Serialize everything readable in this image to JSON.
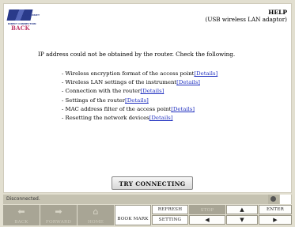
{
  "header": {
    "logo_line1": "INTERNET",
    "logo_line2": "DIRECT CONNECTION",
    "title": "HELP",
    "subtitle": "(USB wireless LAN adaptor)"
  },
  "back_label": "BACK",
  "message": "IP address could not be obtained by the router. Check the following.",
  "details_label": "[Details]",
  "checklist": [
    "- Wireless encryption format of the access point",
    "- Wireless LAN settings of the instrument",
    "- Connection with the router",
    "- Settings of the router",
    "- MAC address filter of the access point",
    "- Resetting the network devices"
  ],
  "try_button": "TRY CONNECTING",
  "status": {
    "text": "Disconnected."
  },
  "toolbar": {
    "back": "BACK",
    "forward": "FORWARD",
    "home": "HOME",
    "bookmark": "BOOK MARK",
    "refresh": "REFRESH",
    "setting": "SETTING",
    "stop": "STOP",
    "enter": "ENTER"
  },
  "icons": [
    "back-arrow-icon",
    "forward-arrow-icon",
    "home-icon",
    "up-arrow-icon",
    "down-arrow-icon",
    "left-arrow-icon",
    "right-arrow-icon"
  ]
}
